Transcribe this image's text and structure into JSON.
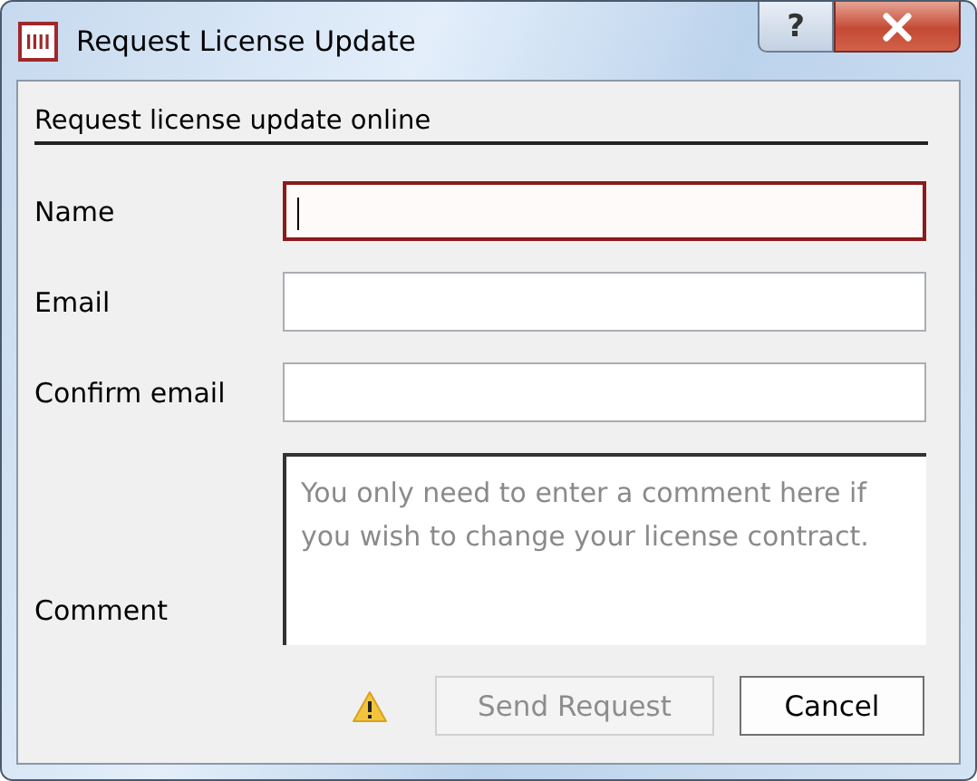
{
  "window": {
    "title": "Request License Update",
    "help_button": "?"
  },
  "section": {
    "heading": "Request license update online"
  },
  "fields": [
    {
      "label": "Name",
      "kind": "text",
      "focused": true
    },
    {
      "label": "Email",
      "kind": "text",
      "focused": false
    },
    {
      "label": "Confirm email",
      "kind": "text",
      "focused": false
    },
    {
      "label": "Comment",
      "kind": "textarea",
      "focused": false,
      "placeholder": "You only need to enter a comment here if you wish to change your license contract."
    }
  ],
  "warning": {
    "shown": true
  },
  "buttons": [
    {
      "label": "Send Request",
      "disabled": true
    },
    {
      "label": "Cancel",
      "disabled": false
    }
  ]
}
